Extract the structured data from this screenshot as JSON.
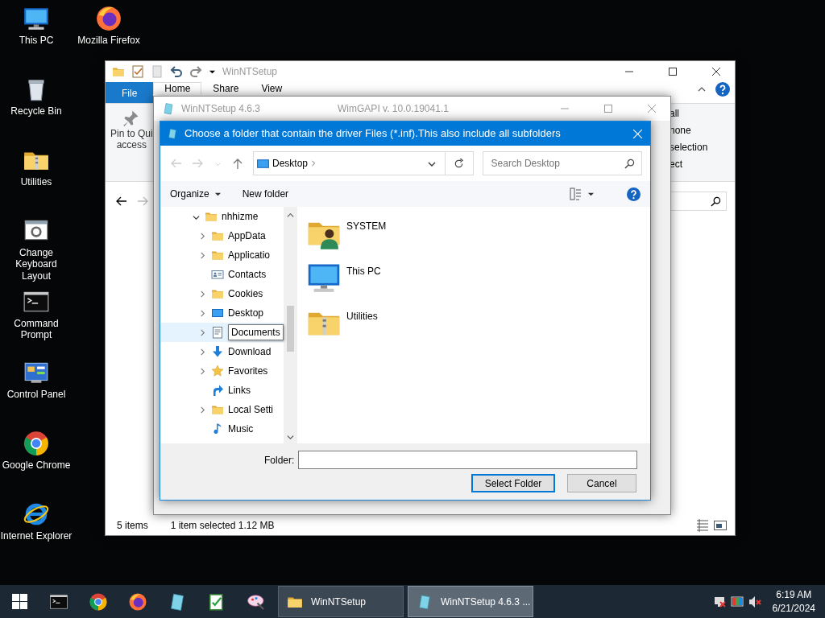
{
  "desktop_icons": [
    {
      "label": "This PC",
      "kind": "pc"
    },
    {
      "label": "Recycle Bin",
      "kind": "recycle"
    },
    {
      "label": "Utilities",
      "kind": "zipfolder"
    },
    {
      "label": "Change Keyboard Layout",
      "kind": "keyboard"
    },
    {
      "label": "Command Prompt",
      "kind": "cmd"
    },
    {
      "label": "Control Panel",
      "kind": "control"
    },
    {
      "label": "Google Chrome",
      "kind": "chrome"
    },
    {
      "label": "Internet Explorer",
      "kind": "ie"
    },
    {
      "label": "Mozilla Firefox",
      "kind": "firefox"
    }
  ],
  "explorer": {
    "title": "WinNTSetup",
    "ribbon_tabs": [
      {
        "label": "File",
        "kind": "menu",
        "selected": false
      },
      {
        "label": "Home",
        "kind": "tab",
        "selected": true
      },
      {
        "label": "Share",
        "kind": "tab",
        "selected": false
      },
      {
        "label": "View",
        "kind": "tab",
        "selected": false
      }
    ],
    "ribbon_left": [
      "Pin to Qui",
      "access"
    ],
    "ribbon_right": [
      "all",
      "none",
      "selection",
      "ect"
    ],
    "status_items": "5 items",
    "status_selection": "1 item selected  1.12 MB"
  },
  "winntsetup": {
    "title": "WinNTSetup 4.6.3",
    "subtitle": "WimGAPI v. 10.0.19041.1"
  },
  "dialog": {
    "title": "Choose a folder that contain the driver Files (*.inf).This also include all subfolders",
    "address": "Desktop",
    "search": {
      "placeholder": "Search Desktop"
    },
    "organize": "Organize",
    "new_folder": "New folder",
    "tree": [
      {
        "label": "nhhizme",
        "kind": "folder",
        "expanded": true,
        "hovered": false,
        "children": [
          {
            "label": "AppData",
            "kind": "folder",
            "expandable": true,
            "hovered": false
          },
          {
            "label": "Applicatio",
            "kind": "folder",
            "expandable": true,
            "hovered": false
          },
          {
            "label": "Contacts",
            "kind": "contacts",
            "expandable": false,
            "hovered": false
          },
          {
            "label": "Cookies",
            "kind": "folder",
            "expandable": true,
            "hovered": false
          },
          {
            "label": "Desktop",
            "kind": "desktop",
            "expandable": true,
            "hovered": false
          },
          {
            "label": "Documents",
            "kind": "documents",
            "expandable": true,
            "hovered": true
          },
          {
            "label": "Download",
            "kind": "downloads",
            "expandable": true,
            "hovered": false
          },
          {
            "label": "Favorites",
            "kind": "favorites",
            "expandable": true,
            "hovered": false
          },
          {
            "label": "Links",
            "kind": "links",
            "expandable": false,
            "hovered": false
          },
          {
            "label": "Local Setti",
            "kind": "folder",
            "expandable": true,
            "hovered": false
          },
          {
            "label": "Music",
            "kind": "music",
            "expandable": false,
            "hovered": false
          }
        ]
      }
    ],
    "items": [
      {
        "label": "SYSTEM",
        "kind": "userfolder"
      },
      {
        "label": "This PC",
        "kind": "pc"
      },
      {
        "label": "Utilities",
        "kind": "zipfolder"
      }
    ],
    "folder_label": "Folder:",
    "buttons": [
      {
        "label": "Select Folder",
        "default": true
      },
      {
        "label": "Cancel",
        "default": false
      }
    ]
  },
  "taskbar": {
    "pinned": [
      {
        "kind": "cmd"
      },
      {
        "kind": "chrome"
      },
      {
        "kind": "firefox"
      },
      {
        "kind": "tablet"
      },
      {
        "kind": "notepad"
      },
      {
        "kind": "paint"
      }
    ],
    "windows": [
      {
        "label": "WinNTSetup",
        "kind": "folder",
        "selected": false
      },
      {
        "label": "WinNTSetup 4.6.3   ...",
        "kind": "tablet",
        "selected": true
      }
    ],
    "time": "6:19 AM",
    "date": "6/21/2024"
  }
}
